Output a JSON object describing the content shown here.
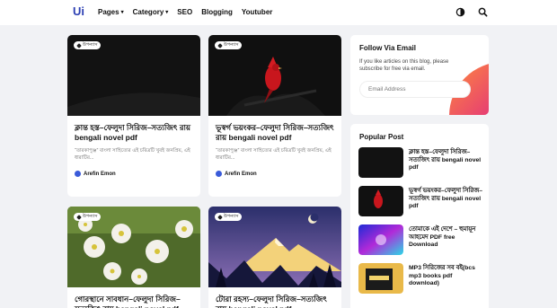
{
  "header": {
    "logo": "Ui",
    "nav": [
      {
        "label": "Pages",
        "caret": "▾"
      },
      {
        "label": "Category",
        "caret": "▾"
      },
      {
        "label": "SEO",
        "caret": ""
      },
      {
        "label": "Blogging",
        "caret": ""
      },
      {
        "label": "Youtuber",
        "caret": ""
      }
    ],
    "icons": [
      "theme-toggle-icon",
      "search-icon"
    ]
  },
  "posts": [
    {
      "tag": "উপন্যাস",
      "title": "ক্লান্ত হস্ত–ফেলুদা সিরিজ–সত্যজিৎ রায় bengali novel pdf",
      "excerpt": "“তারকাপুঞ্জ” বাংলা সাহিত্যের এই চরিত্রটি খুবই জনপ্রিয়, এই ধারাটির...",
      "author": "Arefin Emon",
      "thumb": "dark"
    },
    {
      "tag": "উপন্যাস",
      "title": "ভূস্বর্গ ভয়ংকর–ফেলুদা সিরিজ–সত্যজিৎ রায় bengali novel pdf",
      "excerpt": "“তারকাপুঞ্জ” বাংলা সাহিত্যের এই চরিত্রটি খুবই জনপ্রিয়, এই ধারাটির...",
      "author": "Arefin Emon",
      "thumb": "cardinal"
    },
    {
      "tag": "উপন্যাস",
      "title": "গোরস্থানে সাবধান–ফেলুদা সিরিজ–সত্যজিৎ রায় bengali novel pdf",
      "excerpt": "",
      "author": "",
      "thumb": "flowers"
    },
    {
      "tag": "উপন্যাস",
      "title": "টোরা রহস্য–ফেলুদা সিরিজ–সত্যজিৎ রায় bengali novel pdf",
      "excerpt": "",
      "author": "",
      "thumb": "mountain"
    }
  ],
  "follow": {
    "title": "Follow Via Email",
    "text": "If you like articles on this blog, please subscribe for free via email.",
    "placeholder": "Email Address"
  },
  "popular": {
    "title": "Popular Post",
    "items": [
      {
        "title": "ক্লান্ত হস্ত–ফেলুদা সিরিজ–সত্যজিৎ রায় bengali novel pdf",
        "thumb": "dark"
      },
      {
        "title": "ভূস্বর্গ ভয়ংকর–ফেলুদা সিরিজ–সত্যজিৎ রায় bengali novel pdf",
        "thumb": "cardinal"
      },
      {
        "title": "তোমাকে এই দেশে – হুমায়ূন আহমেদ PDF free Download",
        "thumb": "neon"
      },
      {
        "title": "MP3 সিরিজের সব বই(bcs mp3 books pdf download)",
        "thumb": "book"
      }
    ]
  }
}
